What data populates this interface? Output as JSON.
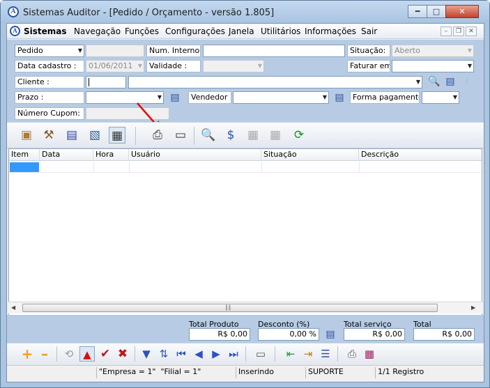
{
  "window": {
    "title": "Sistemas Auditor - [Pedido / Orçamento - versão 1.805]"
  },
  "menu": [
    "Sistemas",
    "Navegação",
    "Funções",
    "Configurações",
    "Janela",
    "Utilitários",
    "Informações",
    "Sair"
  ],
  "form": {
    "type_value": "Pedido",
    "num_interno_label": "Num. Interno :",
    "situacao_label": "Situação:",
    "situacao_value": "Aberto",
    "data_cadastro_label": "Data cadastro :",
    "data_cadastro_value": "01/06/2011",
    "validade_label": "Validade :",
    "faturar_label": "Faturar em:",
    "cliente_label": "Cliente :",
    "prazo_label": "Prazo :",
    "vendedor_label": "Vendedor :",
    "forma_pagamento_label": "Forma pagamento:",
    "numero_cupom_label": "Número Cupom:"
  },
  "grid": {
    "columns": [
      "Item",
      "Data",
      "Hora",
      "Usuário",
      "Situação",
      "Descrição"
    ]
  },
  "totals": {
    "total_produto_label": "Total Produto",
    "total_produto_value": "R$ 0,00",
    "desconto_label": "Desconto (%)",
    "desconto_value": "0,00 %",
    "total_servico_label": "Total serviço",
    "total_servico_value": "R$ 0,00",
    "total_label": "Total",
    "total_value": "R$ 0,00"
  },
  "status": {
    "empresa": "\"Empresa = 1\"",
    "filial": "\"Filial = 1\"",
    "mode": "Inserindo",
    "user": "SUPORTE",
    "registro": "1/1 Registro"
  },
  "colors": {
    "accent": "#2b52a3",
    "panel": "#b7cbe4",
    "selection": "#3399ff"
  }
}
